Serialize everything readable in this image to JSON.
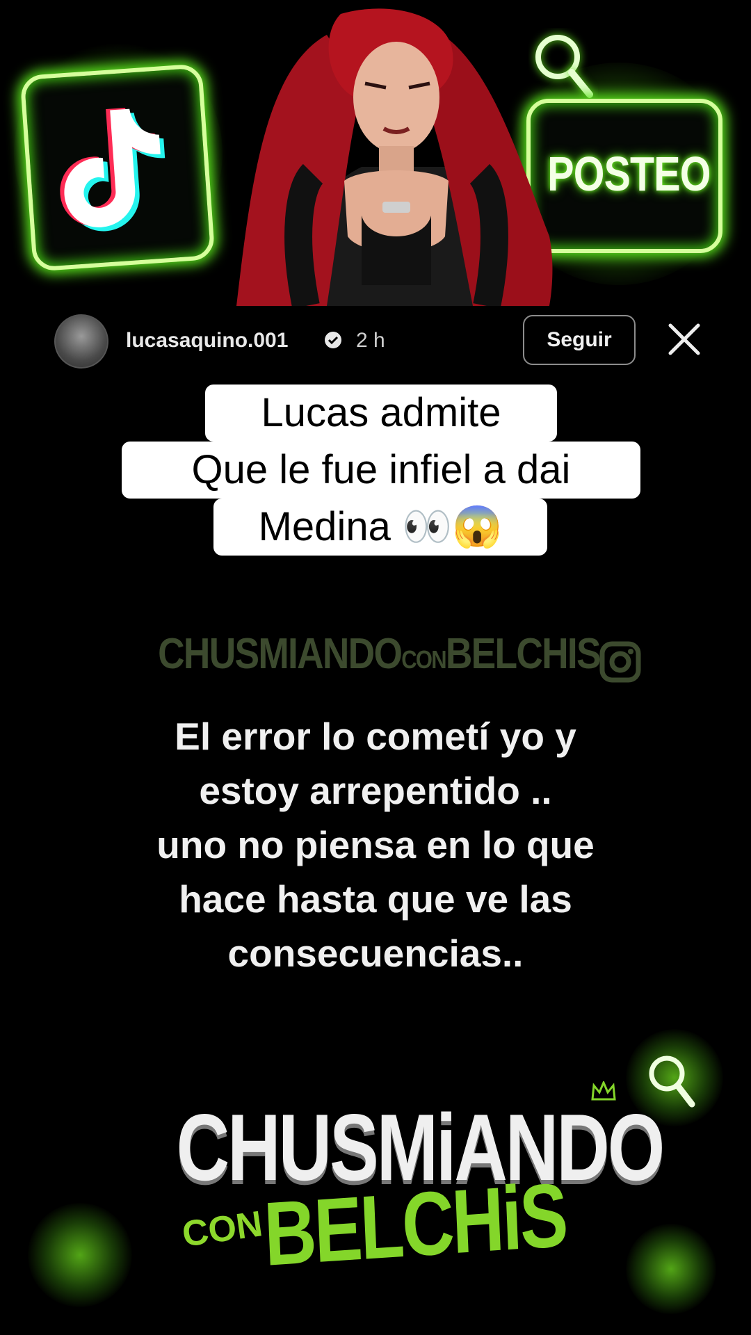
{
  "post": {
    "username": "lucasaquino.001",
    "time_ago": "2 h",
    "follow_label": "Seguir"
  },
  "overlay": {
    "posteo_label": "POSTEO"
  },
  "caption": {
    "line1": "Lucas admite",
    "line2": "Que le fue infiel a dai",
    "line3": "Medina 👀😱"
  },
  "watermark": {
    "part1": "CHUSMIANDO",
    "part2": "CON",
    "part3": "BELCHIS"
  },
  "quote": {
    "line1": "El error lo cometí yo y",
    "line2": "estoy arrepentido ..",
    "line3": "uno no piensa en lo que",
    "line4": "hace hasta que ve las",
    "line5": "consecuencias.."
  },
  "logo": {
    "main": "CHUSMiANDO",
    "con": "CON",
    "belchis": "BELCHiS"
  },
  "colors": {
    "neon_green": "#58e01c",
    "caption_bg": "#ffffff",
    "logo_green": "#84d62a"
  },
  "icons": [
    "tiktok-logo-icon",
    "search-icon",
    "verified-icon",
    "close-icon",
    "instagram-icon",
    "crown-icon"
  ]
}
